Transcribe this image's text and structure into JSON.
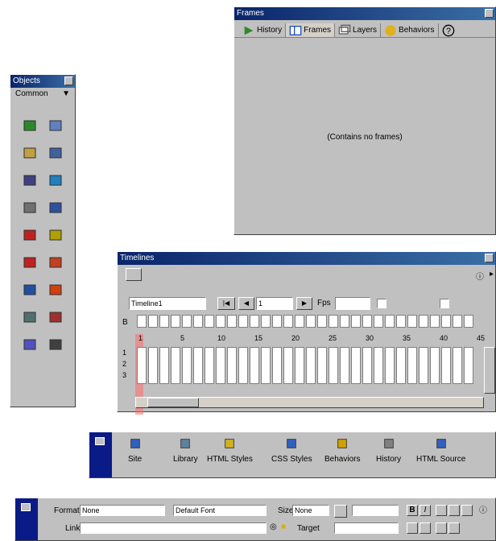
{
  "colors": {
    "title_bar": "#0a246a",
    "panel": "#c0c0c0",
    "dock_tab": "#0a1a86",
    "playhead": "#ff6b6b"
  },
  "frames_panel": {
    "title": "Frames",
    "tabs": [
      {
        "label": "History",
        "icon": "history-icon"
      },
      {
        "label": "Frames",
        "icon": "frames-icon"
      },
      {
        "label": "Layers",
        "icon": "layers-icon"
      },
      {
        "label": "Behaviors",
        "icon": "behaviors-icon"
      }
    ],
    "empty_message": "(Contains no frames)"
  },
  "objects_panel": {
    "title": "Objects",
    "category": "Common",
    "icons": [
      "insert-image-icon",
      "insert-rollover-icon",
      "insert-table-icon",
      "insert-tabular-data-icon",
      "insert-horizontal-rule-icon",
      "insert-navigation-bar-icon",
      "insert-layer-icon",
      "insert-line-break-icon",
      "insert-email-link-icon",
      "insert-date-icon",
      "insert-flash-icon",
      "insert-shockwave-icon",
      "insert-generator-icon",
      "insert-fireworks-icon",
      "insert-applet-icon",
      "insert-activex-icon",
      "insert-plugin-icon",
      "insert-server-include-icon"
    ]
  },
  "timelines_panel": {
    "title": "Timelines",
    "timeline_name": "Timeline1",
    "frame_value": "1",
    "fps_label": "Fps",
    "frame_numbers": [
      "1",
      "5",
      "10",
      "15",
      "20",
      "25",
      "30",
      "35",
      "40",
      "45"
    ],
    "row_labels": [
      "B",
      "1",
      "2",
      "3"
    ]
  },
  "launcher": {
    "buttons": [
      {
        "label": "Site",
        "icon": "site-icon"
      },
      {
        "label": "Library",
        "icon": "library-icon"
      },
      {
        "label": "HTML Styles",
        "icon": "html-styles-icon"
      },
      {
        "label": "CSS Styles",
        "icon": "css-styles-icon"
      },
      {
        "label": "Behaviors",
        "icon": "behaviors-icon"
      },
      {
        "label": "History",
        "icon": "history-icon"
      },
      {
        "label": "HTML Source",
        "icon": "html-source-icon"
      }
    ]
  },
  "properties": {
    "format_label": "Format",
    "format_value": "None",
    "font_value": "Default Font",
    "size_label": "Size",
    "size_value": "None",
    "link_label": "Link",
    "target_label": "Target",
    "bold": "B",
    "italic": "I"
  }
}
